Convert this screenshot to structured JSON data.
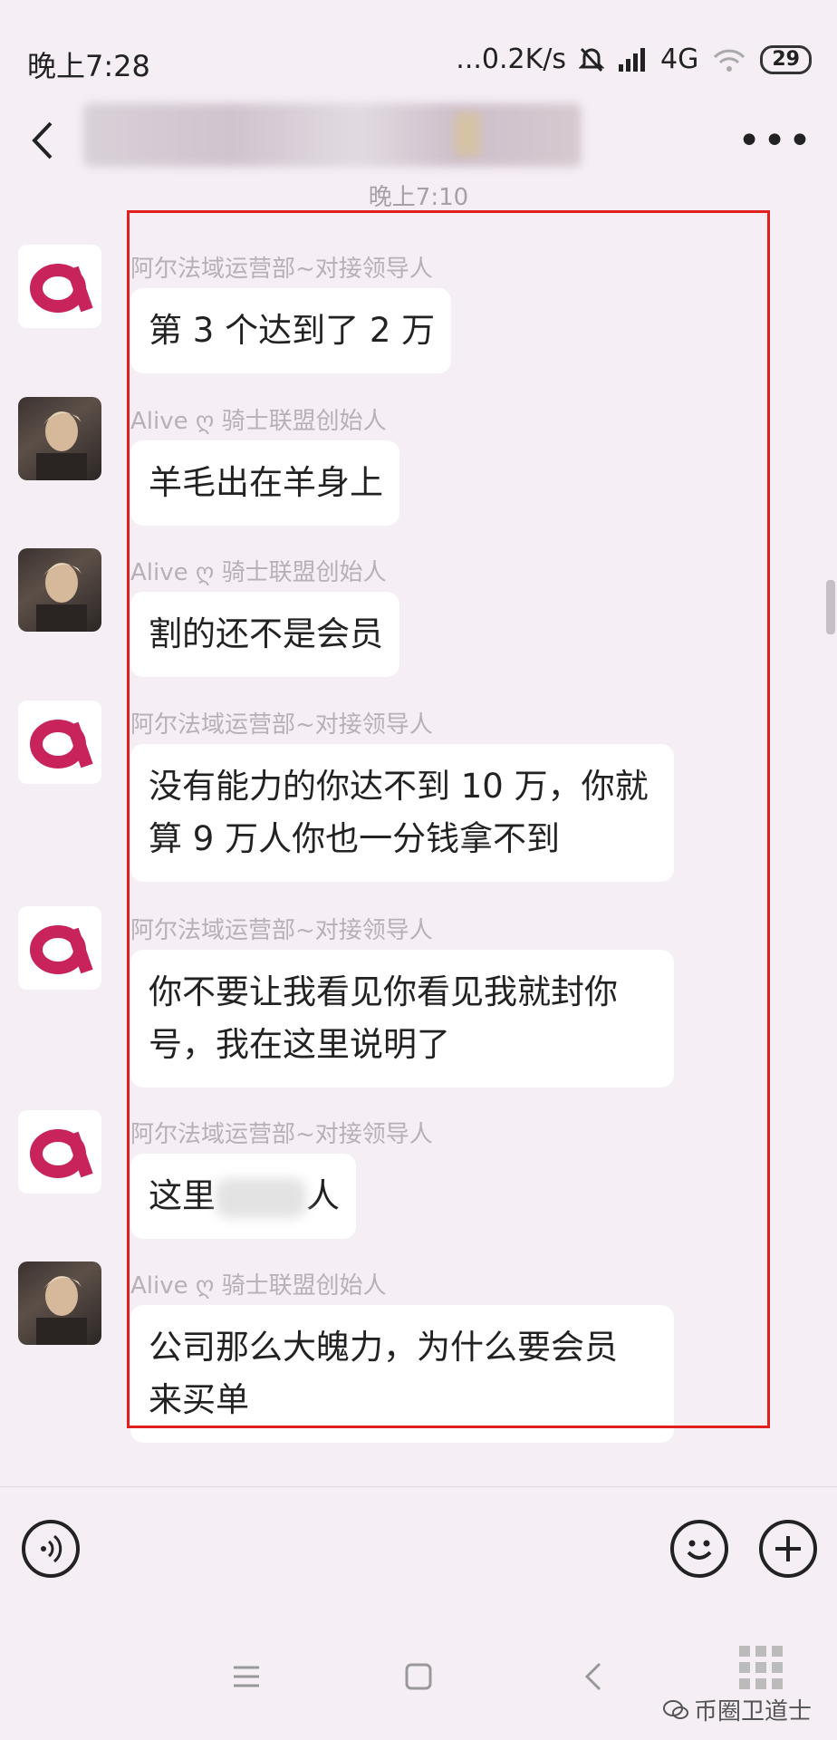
{
  "status_bar": {
    "time": "晚上7:28",
    "network_speed": "...0.2K/s",
    "signal": "4G",
    "battery": "29"
  },
  "header": {
    "title": ""
  },
  "chat": {
    "timestamp": "晚上7:10",
    "messages": [
      {
        "sender": "阿尔法域运营部~对接领导人",
        "text": "第 3 个达到了 2 万",
        "avatar": "brand"
      },
      {
        "sender": "Alive ღ 骑士联盟创始人",
        "text": "羊毛出在羊身上",
        "avatar": "photo"
      },
      {
        "sender": "Alive ღ 骑士联盟创始人",
        "text": "割的还不是会员",
        "avatar": "photo"
      },
      {
        "sender": "阿尔法域运营部~对接领导人",
        "text": "没有能力的你达不到 10 万，你就\n算 9 万人你也一分钱拿不到",
        "avatar": "brand"
      },
      {
        "sender": "阿尔法域运营部~对接领导人",
        "text": "你不要让我看见你看见我就封你\n号，我在这里说明了",
        "avatar": "brand"
      },
      {
        "sender": "阿尔法域运营部~对接领导人",
        "text_before": "这里",
        "text_after": "人",
        "avatar": "brand"
      },
      {
        "sender": "Alive ღ 骑士联盟创始人",
        "text": "公司那么大魄力，为什么要会员\n来买单",
        "avatar": "photo"
      }
    ]
  },
  "watermark": "币圈卫道士",
  "colors": {
    "highlight": "#e02020",
    "brand": "#c8235a",
    "background": "#f6eef5"
  }
}
